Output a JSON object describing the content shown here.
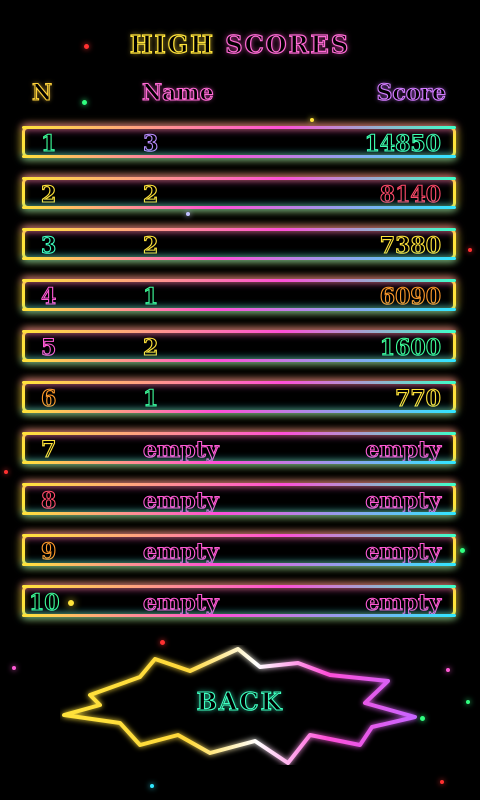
{
  "title": {
    "word1": "HIGH",
    "word2": "SCORES"
  },
  "headers": {
    "n": "N",
    "name": "Name",
    "score": "Score"
  },
  "rows": [
    {
      "n": "1",
      "name": "3",
      "score": "14850"
    },
    {
      "n": "2",
      "name": "2",
      "score": "8140"
    },
    {
      "n": "3",
      "name": "2",
      "score": "7380"
    },
    {
      "n": "4",
      "name": "1",
      "score": "6090"
    },
    {
      "n": "5",
      "name": "2",
      "score": "1600"
    },
    {
      "n": "6",
      "name": "1",
      "score": "770"
    },
    {
      "n": "7",
      "name": "empty",
      "score": "empty"
    },
    {
      "n": "8",
      "name": "empty",
      "score": "empty"
    },
    {
      "n": "9",
      "name": "empty",
      "score": "empty"
    },
    {
      "n": "10",
      "name": "empty",
      "score": "empty"
    }
  ],
  "back_button": {
    "label": "BACK"
  },
  "colors": {
    "background": "#000000",
    "neon_yellow": "#ffe33a",
    "neon_pink": "#ff4fd8",
    "neon_cyan": "#30e7ff",
    "neon_green": "#3dffa8"
  }
}
